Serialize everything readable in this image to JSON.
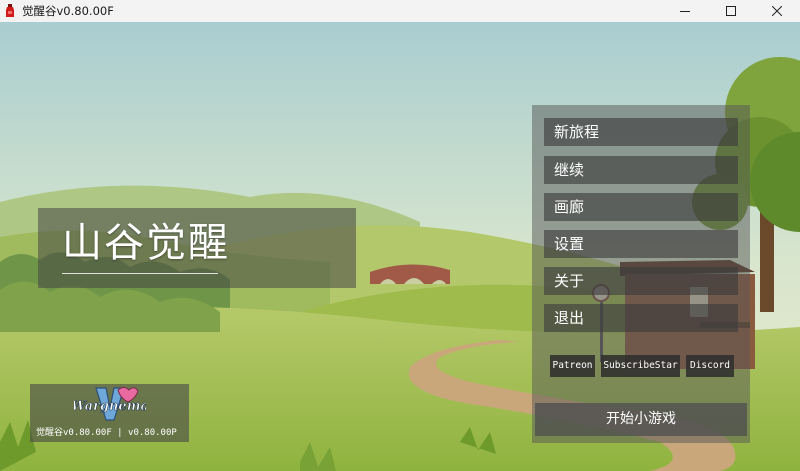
{
  "window": {
    "title": "觉醒谷v0.80.00F",
    "icon": "red-bottle-icon",
    "controls": [
      "minimize-icon",
      "maximize-icon",
      "close-icon"
    ]
  },
  "game": {
    "title": "山谷觉醒"
  },
  "menu": {
    "items": [
      "新旅程",
      "继续",
      "画廊",
      "设置",
      "关于",
      "退出"
    ],
    "links": [
      "Patreon",
      "SubscribeStar",
      "Discord"
    ],
    "minigame": "开始小游戏"
  },
  "footer": {
    "logo_text": "Wargnema",
    "version": "觉醒谷v0.80.00F | v0.80.00P"
  },
  "colors": {
    "sky": "#dbe7cf",
    "grass": "#a4bb52",
    "path": "#c9a77a",
    "panel": "#555555"
  }
}
